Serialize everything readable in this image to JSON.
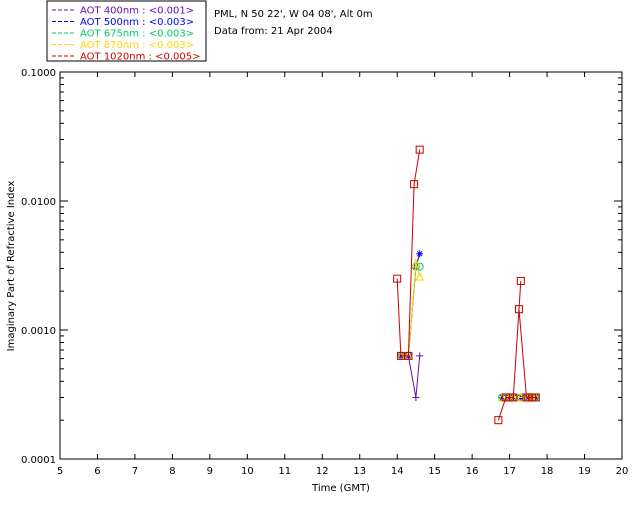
{
  "header": {
    "station": "PML, N 50 22', W 04 08', Alt 0m",
    "date": "Data from: 21 Apr 2004"
  },
  "chart_data": {
    "type": "line",
    "xlabel": "Time (GMT)",
    "ylabel": "Imaginary Part of Refractive Index",
    "xlim": [
      5,
      20
    ],
    "ylim": [
      0.0001,
      0.1
    ],
    "yscale": "log",
    "xticks": [
      "5",
      "6",
      "7",
      "8",
      "9",
      "10",
      "11",
      "12",
      "13",
      "14",
      "15",
      "16",
      "17",
      "18",
      "19",
      "20"
    ],
    "yticks": [
      "0.0001",
      "0.0010",
      "0.0100",
      "0.1000"
    ],
    "legend_position": "top-left, outside plot",
    "series": [
      {
        "name": "AOT  400nm : <0.001>",
        "color": "#6a0dad",
        "marker": "plus",
        "segments": [
          [
            [
              14.1,
              0.00063
            ],
            [
              14.3,
              0.00063
            ],
            [
              14.5,
              0.0003
            ],
            [
              14.6,
              0.00063
            ]
          ],
          [
            [
              16.8,
              0.0003
            ],
            [
              17.0,
              0.0003
            ],
            [
              17.1,
              0.0003
            ],
            [
              17.3,
              0.0003
            ],
            [
              17.5,
              0.0003
            ],
            [
              17.6,
              0.0003
            ],
            [
              17.7,
              0.0003
            ]
          ]
        ]
      },
      {
        "name": "AOT  500nm : <0.003>",
        "color": "#0000ff",
        "marker": "asterisk",
        "segments": [
          [
            [
              14.1,
              0.00063
            ],
            [
              14.3,
              0.00063
            ],
            [
              14.5,
              0.0031
            ],
            [
              14.6,
              0.0039
            ]
          ],
          [
            [
              16.8,
              0.0003
            ],
            [
              17.0,
              0.0003
            ],
            [
              17.1,
              0.0003
            ],
            [
              17.3,
              0.0003
            ],
            [
              17.5,
              0.0003
            ],
            [
              17.6,
              0.0003
            ],
            [
              17.7,
              0.0003
            ]
          ]
        ]
      },
      {
        "name": "AOT  675nm : <0.003>",
        "color": "#00cc66",
        "marker": "circle",
        "segments": [
          [
            [
              14.1,
              0.00063
            ],
            [
              14.3,
              0.00063
            ],
            [
              14.5,
              0.0031
            ],
            [
              14.6,
              0.0031
            ]
          ],
          [
            [
              16.8,
              0.0003
            ],
            [
              17.0,
              0.0003
            ],
            [
              17.1,
              0.0003
            ],
            [
              17.3,
              0.0003
            ],
            [
              17.5,
              0.0003
            ],
            [
              17.6,
              0.0003
            ],
            [
              17.7,
              0.0003
            ]
          ]
        ]
      },
      {
        "name": "AOT  870nm : <0.003>",
        "color": "#ffd700",
        "marker": "triangle",
        "segments": [
          [
            [
              14.1,
              0.00063
            ],
            [
              14.3,
              0.00063
            ],
            [
              14.5,
              0.0033
            ],
            [
              14.6,
              0.0026
            ]
          ],
          [
            [
              16.8,
              0.0003
            ],
            [
              17.0,
              0.0003
            ],
            [
              17.1,
              0.0003
            ],
            [
              17.3,
              0.0003
            ],
            [
              17.5,
              0.0003
            ],
            [
              17.6,
              0.0003
            ],
            [
              17.7,
              0.0003
            ]
          ]
        ]
      },
      {
        "name": "AOT 1020nm : <0.005>",
        "color": "#cc0000",
        "marker": "square",
        "segments": [
          [
            [
              14.0,
              0.0025
            ],
            [
              14.1,
              0.00063
            ],
            [
              14.3,
              0.00063
            ],
            [
              14.45,
              0.0135
            ],
            [
              14.6,
              0.025
            ]
          ],
          [
            [
              16.7,
              0.0002
            ],
            [
              16.9,
              0.0003
            ],
            [
              17.0,
              0.0003
            ],
            [
              17.1,
              0.0003
            ],
            [
              17.3,
              0.0024
            ],
            [
              17.25,
              0.00145
            ],
            [
              17.45,
              0.0003
            ],
            [
              17.5,
              0.0003
            ],
            [
              17.6,
              0.0003
            ],
            [
              17.7,
              0.0003
            ]
          ]
        ]
      }
    ]
  }
}
